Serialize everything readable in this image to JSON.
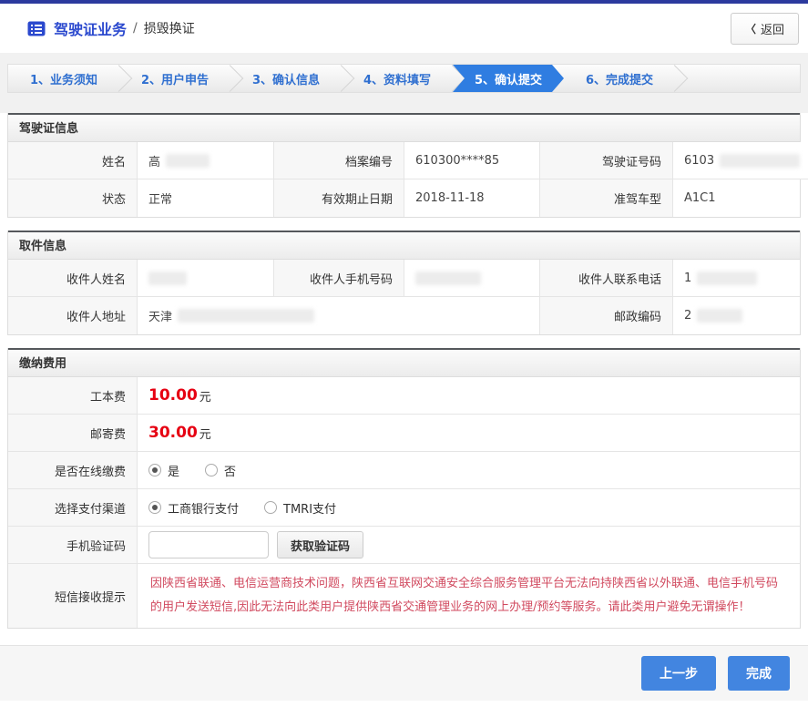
{
  "page": {
    "title_primary": "驾驶证业务",
    "title_separator": "/",
    "title_secondary": "损毁换证",
    "back_chevron": "〈",
    "back_label": "返回"
  },
  "steps": {
    "active_index": 4,
    "items": [
      {
        "label": "1、业务须知"
      },
      {
        "label": "2、用户申告"
      },
      {
        "label": "3、确认信息"
      },
      {
        "label": "4、资料填写"
      },
      {
        "label": "5、确认提交"
      },
      {
        "label": "6、完成提交"
      }
    ]
  },
  "license": {
    "title": "驾驶证信息",
    "name_label": "姓名",
    "name_value": "高",
    "file_no_label": "档案编号",
    "file_no_value": "610300****85",
    "license_no_label": "驾驶证号码",
    "license_no_value": "6103",
    "status_label": "状态",
    "status_value": "正常",
    "expiry_label": "有效期止日期",
    "expiry_value": "2018-11-18",
    "vehicle_label": "准驾车型",
    "vehicle_value": "A1C1"
  },
  "pickup": {
    "title": "取件信息",
    "recipient_name_label": "收件人姓名",
    "recipient_name_value": "",
    "recipient_mobile_label": "收件人手机号码",
    "recipient_mobile_value": "",
    "recipient_phone_label": "收件人联系电话",
    "recipient_phone_value": "1",
    "address_label": "收件人地址",
    "address_value": "天津",
    "postcode_label": "邮政编码",
    "postcode_value": "2"
  },
  "payment": {
    "title": "缴纳费用",
    "work_fee_label": "工本费",
    "work_fee_amount": "10.00",
    "work_fee_unit": "元",
    "mail_fee_label": "邮寄费",
    "mail_fee_amount": "30.00",
    "mail_fee_unit": "元",
    "online_label": "是否在线缴费",
    "online_yes": "是",
    "online_no": "否",
    "channel_label": "选择支付渠道",
    "channel_icbc": "工商银行支付",
    "channel_tmri": "TMRI支付",
    "captcha_label": "手机验证码",
    "captcha_value": "",
    "captcha_button": "获取验证码",
    "notice_label": "短信接收提示",
    "notice_text": "因陕西省联通、电信运营商技术问题，陕西省互联网交通安全综合服务管理平台无法向持陕西省以外联通、电信手机号码的用户发送短信,因此无法向此类用户提供陕西省交通管理业务的网上办理/预约等服务。请此类用户避免无谓操作！"
  },
  "footer": {
    "prev_label": "上一步",
    "finish_label": "完成"
  },
  "colors": {
    "topbar_blue": "#2c3a9e",
    "title_blue": "#2b49ce",
    "step_active_blue": "#2f7de1",
    "step_text_blue": "#2f6fd0",
    "fee_red": "#e60012",
    "notice_red": "#d14a5f",
    "button_blue": "#4285e0"
  }
}
